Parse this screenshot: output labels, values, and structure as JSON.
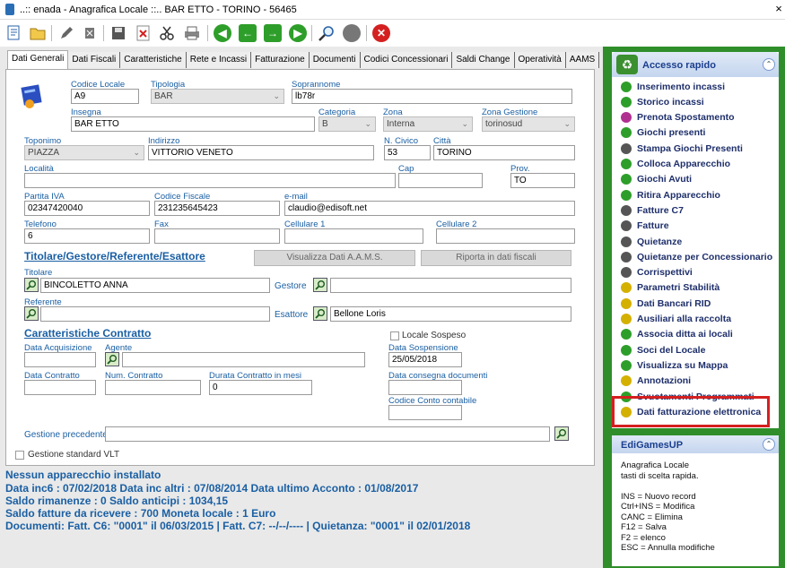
{
  "window": {
    "title": "..:: enada - Anagrafica Locale ::.. BAR ETTO - TORINO - 56465",
    "close_glyph": "×"
  },
  "toolbar": {
    "icons": [
      "new-doc-icon",
      "open-folder-icon",
      "edit-icon",
      "delete-icon",
      "save-icon",
      "cancel-icon",
      "cut-icon",
      "print-icon",
      "first-record-icon",
      "prev-record-icon",
      "next-record-icon",
      "last-record-icon",
      "search-icon",
      "refresh-icon",
      "close-icon"
    ],
    "colors": {
      "nav": "#2e9e2a",
      "close": "#d42020"
    }
  },
  "tabs": [
    "Dati Generali",
    "Dati Fiscali",
    "Caratteristiche",
    "Rete e Incassi",
    "Fatturazione",
    "Documenti",
    "Codici Concessionari",
    "Saldi Change",
    "Operatività",
    "AAMS"
  ],
  "form": {
    "codice_locale": {
      "label": "Codice Locale",
      "value": "A9"
    },
    "tipologia": {
      "label": "Tipologia",
      "value": "BAR"
    },
    "soprannome": {
      "label": "Soprannome",
      "value": "lb78r"
    },
    "insegna": {
      "label": "Insegna",
      "value": "BAR ETTO"
    },
    "categoria": {
      "label": "Categoria",
      "value": "B"
    },
    "zona": {
      "label": "Zona",
      "value": "Interna"
    },
    "zona_gestione": {
      "label": "Zona Gestione",
      "value": "torinosud"
    },
    "toponimo": {
      "label": "Toponimo",
      "value": "PIAZZA"
    },
    "indirizzo": {
      "label": "Indirizzo",
      "value": "VITTORIO VENETO"
    },
    "n_civico": {
      "label": "N. Civico",
      "value": "53"
    },
    "citta": {
      "label": "Città",
      "value": "TORINO"
    },
    "localita": {
      "label": "Località",
      "value": ""
    },
    "cap": {
      "label": "Cap",
      "value": ""
    },
    "prov": {
      "label": "Prov.",
      "value": "TO"
    },
    "partita_iva": {
      "label": "Partita IVA",
      "value": "02347420040"
    },
    "codice_fiscale": {
      "label": "Codice Fiscale",
      "value": "231235645423"
    },
    "email": {
      "label": "e-mail",
      "value": "claudio@edisoft.net"
    },
    "telefono": {
      "label": "Telefono",
      "value": "6"
    },
    "fax": {
      "label": "Fax",
      "value": ""
    },
    "cellulare1": {
      "label": "Cellulare 1",
      "value": ""
    },
    "cellulare2": {
      "label": "Cellulare 2",
      "value": ""
    },
    "section_titolare": "Titolare/Gestore/Referente/Esattore",
    "btn_visualizza": "Visualizza Dati A.A.M.S.",
    "btn_riporta": "Riporta in dati fiscali",
    "titolare": {
      "label": "Titolare",
      "value": "BINCOLETTO ANNA"
    },
    "gestore": {
      "label": "Gestore",
      "value": ""
    },
    "referente": {
      "label": "Referente",
      "value": ""
    },
    "esattore": {
      "label": "Esattore",
      "value": "Bellone Loris"
    },
    "section_contratto": "Caratteristiche Contratto",
    "locale_sospeso": "Locale Sospeso",
    "data_acquisizione": {
      "label": "Data Acquisizione",
      "value": ""
    },
    "agente": {
      "label": "Agente",
      "value": ""
    },
    "data_sospensione": {
      "label": "Data Sospensione",
      "value": "25/05/2018"
    },
    "data_contratto": {
      "label": "Data Contratto",
      "value": ""
    },
    "num_contratto": {
      "label": "Num. Contratto",
      "value": ""
    },
    "durata_contratto": {
      "label": "Durata Contratto in mesi",
      "value": "0"
    },
    "data_consegna": {
      "label": "Data consegna documenti",
      "value": ""
    },
    "codice_conto": {
      "label": "Codice Conto contabile",
      "value": ""
    },
    "gestione_precedente": {
      "label": "Gestione precedente",
      "value": ""
    },
    "gestione_vlt": "Gestione standard VLT"
  },
  "status": [
    "Nessun apparecchio installato",
    "Data inc6 : 07/02/2018    Data inc altri : 07/08/2014    Data ultimo Acconto : 01/08/2017",
    "Saldo rimanenze : 0     Saldo anticipi : 1034,15",
    "Saldo fatture da ricevere : 700     Moneta locale : 1 Euro",
    "Documenti: Fatt. C6: \"0001\" il 06/03/2015 | Fatt. C7: --/--/---- | Quietanza: \"0001\" il 02/01/2018"
  ],
  "quick_access": {
    "title": "Accesso rapido",
    "items": [
      {
        "label": "Inserimento incassi",
        "icon": "green-circle-icon",
        "color": "#2e9e2a"
      },
      {
        "label": "Storico incassi",
        "icon": "green-circle-icon",
        "color": "#2e9e2a"
      },
      {
        "label": "Prenota Spostamento",
        "icon": "puzzle-icon",
        "color": "#b03090"
      },
      {
        "label": "Giochi presenti",
        "icon": "green-circle-icon",
        "color": "#2e9e2a"
      },
      {
        "label": "Stampa Giochi Presenti",
        "icon": "gear-icon",
        "color": "#555555"
      },
      {
        "label": "Colloca Apparecchio",
        "icon": "arrow-right-icon",
        "color": "#2e9e2a"
      },
      {
        "label": "Giochi Avuti",
        "icon": "green-circle-icon",
        "color": "#2e9e2a"
      },
      {
        "label": "Ritira Apparecchio",
        "icon": "arrow-left-icon",
        "color": "#2e9e2a"
      },
      {
        "label": "Fatture C7",
        "icon": "gear-icon",
        "color": "#555555"
      },
      {
        "label": "Fatture",
        "icon": "gear-icon",
        "color": "#555555"
      },
      {
        "label": "Quietanze",
        "icon": "gear-icon",
        "color": "#555555"
      },
      {
        "label": "Quietanze per Concessionario",
        "icon": "gear-icon",
        "color": "#555555"
      },
      {
        "label": "Corrispettivi",
        "icon": "gear-icon",
        "color": "#555555"
      },
      {
        "label": "Parametri Stabilità",
        "icon": "wrench-icon",
        "color": "#d4b000"
      },
      {
        "label": "Dati Bancari RID",
        "icon": "wrench-icon",
        "color": "#d4b000"
      },
      {
        "label": "Ausiliari alla raccolta",
        "icon": "wrench-icon",
        "color": "#d4b000"
      },
      {
        "label": "Associa ditta ai locali",
        "icon": "recycle-icon",
        "color": "#2e9e2a"
      },
      {
        "label": "Soci del Locale",
        "icon": "recycle-icon",
        "color": "#2e9e2a"
      },
      {
        "label": "Visualizza su Mappa",
        "icon": "recycle-icon",
        "color": "#2e9e2a"
      },
      {
        "label": "Annotazioni",
        "icon": "wrench-icon",
        "color": "#d4b000"
      },
      {
        "label": "Svuotamenti Programmati",
        "icon": "recycle-icon",
        "color": "#2e9e2a"
      },
      {
        "label": "Dati fatturazione elettronica",
        "icon": "wrench-icon",
        "color": "#d4b000"
      }
    ],
    "highlight_color": "#d42020"
  },
  "edigames": {
    "title": "EdiGamesUP",
    "lines": [
      "Anagrafica Locale",
      "tasti di scelta rapida.",
      "",
      "INS = Nuovo record",
      "Ctrl+INS = Modifica",
      "CANC = Elimina",
      "F12 = Salva",
      "F2 = elenco",
      "ESC = Annulla modifiche"
    ]
  }
}
